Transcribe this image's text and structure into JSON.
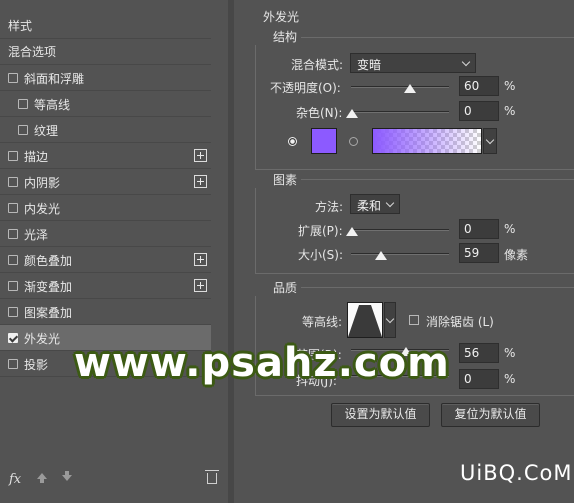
{
  "left_panel": {
    "header": "样式",
    "blend_options": "混合选项",
    "items": [
      {
        "label": "斜面和浮雕",
        "checked": false,
        "indent": false,
        "plus": false
      },
      {
        "label": "等高线",
        "checked": false,
        "indent": true,
        "plus": false
      },
      {
        "label": "纹理",
        "checked": false,
        "indent": true,
        "plus": false
      },
      {
        "label": "描边",
        "checked": false,
        "indent": false,
        "plus": true
      },
      {
        "label": "内阴影",
        "checked": false,
        "indent": false,
        "plus": true
      },
      {
        "label": "内发光",
        "checked": false,
        "indent": false,
        "plus": false
      },
      {
        "label": "光泽",
        "checked": false,
        "indent": false,
        "plus": false
      },
      {
        "label": "颜色叠加",
        "checked": false,
        "indent": false,
        "plus": true
      },
      {
        "label": "渐变叠加",
        "checked": false,
        "indent": false,
        "plus": true
      },
      {
        "label": "图案叠加",
        "checked": false,
        "indent": false,
        "plus": false
      },
      {
        "label": "外发光",
        "checked": true,
        "indent": false,
        "plus": false,
        "selected": true
      },
      {
        "label": "投影",
        "checked": false,
        "indent": false,
        "plus": true
      }
    ],
    "footer": {
      "fx_label": "fx"
    }
  },
  "outer_glow": {
    "title": "外发光",
    "structure": {
      "title": "结构",
      "blend_mode_label": "混合模式:",
      "blend_mode_value": "变暗",
      "opacity_label": "不透明度(O):",
      "opacity_value": "60",
      "opacity_unit": "%",
      "noise_label": "杂色(N):",
      "noise_value": "0",
      "noise_unit": "%",
      "glow_color": "#8c5aff"
    },
    "elements": {
      "title": "图素",
      "method_label": "方法:",
      "method_value": "柔和",
      "spread_label": "扩展(P):",
      "spread_value": "0",
      "spread_unit": "%",
      "size_label": "大小(S):",
      "size_value": "59",
      "size_unit": "像素"
    },
    "quality": {
      "title": "品质",
      "contour_label": "等高线:",
      "antialias_label": "消除锯齿 (L)",
      "range_label": "范围(R):",
      "range_value": "56",
      "range_unit": "%",
      "jitter_label": "抖动(J):",
      "jitter_value": "0",
      "jitter_unit": "%"
    },
    "buttons": {
      "make_default": "设置为默认值",
      "reset_default": "复位为默认值"
    }
  },
  "watermarks": {
    "main": "www.psahz.com",
    "corner": "UiBQ.CoM"
  }
}
